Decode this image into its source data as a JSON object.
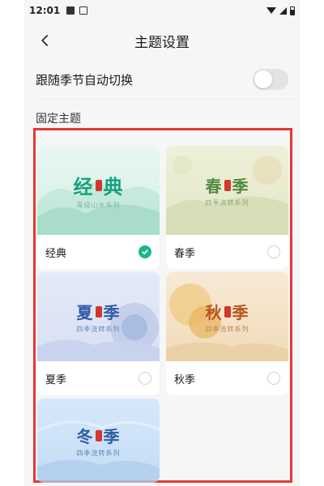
{
  "status_bar": {
    "time": "12:01"
  },
  "header": {
    "title": "主题设置"
  },
  "auto_switch": {
    "label": "跟随季节自动切换",
    "enabled": false
  },
  "section": {
    "label": "固定主题"
  },
  "themes": [
    {
      "thumb_title_a": "经",
      "thumb_title_b": "典",
      "thumb_subtitle": "青绿山水系列",
      "label": "经典",
      "selected": true
    },
    {
      "thumb_title_a": "春",
      "thumb_title_b": "季",
      "thumb_subtitle": "四季流转系列",
      "label": "春季",
      "selected": false
    },
    {
      "thumb_title_a": "夏",
      "thumb_title_b": "季",
      "thumb_subtitle": "四季流转系列",
      "label": "夏季",
      "selected": false
    },
    {
      "thumb_title_a": "秋",
      "thumb_title_b": "季",
      "thumb_subtitle": "四季流转系列",
      "label": "秋季",
      "selected": false
    },
    {
      "thumb_title_a": "冬",
      "thumb_title_b": "季",
      "thumb_subtitle": "四季流转系列",
      "selected": false
    }
  ],
  "colors": {
    "accent": "#19b58b",
    "highlight_border": "#e53935"
  }
}
